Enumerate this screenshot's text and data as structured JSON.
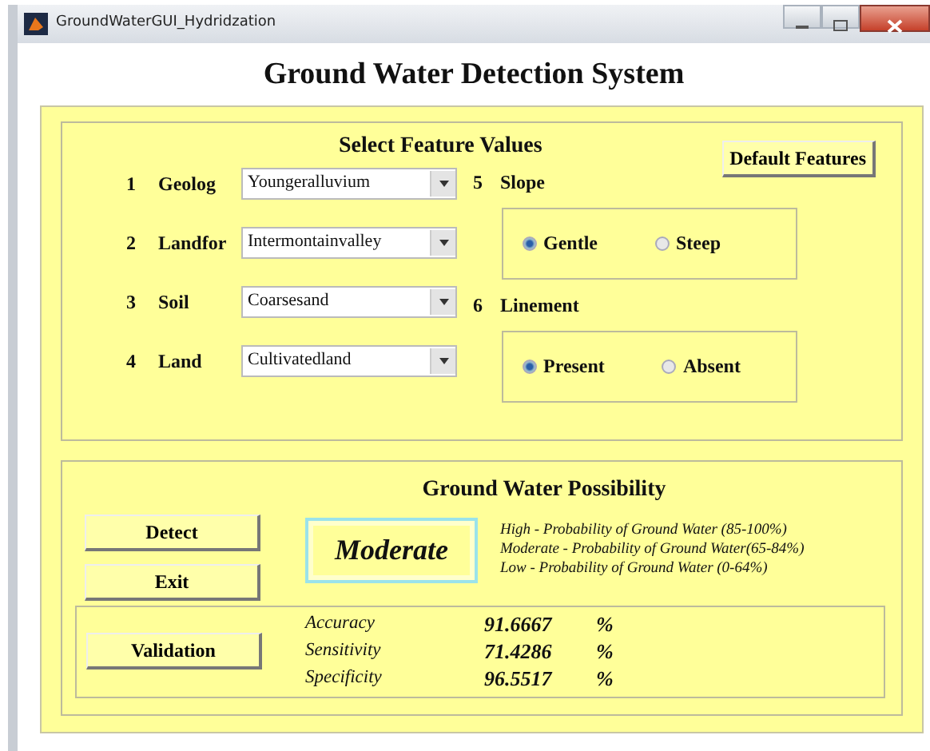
{
  "window": {
    "title": "GroundWaterGUI_Hydridzation"
  },
  "heading": "Ground Water Detection System",
  "features": {
    "title": "Select Feature Values",
    "default_button": "Default Features",
    "dropdowns": [
      {
        "number": "1",
        "label": "Geolog",
        "value": "Youngeralluvium"
      },
      {
        "number": "2",
        "label": "Landfor",
        "value": "Intermontainvalley"
      },
      {
        "number": "3",
        "label": "Soil",
        "value": "Coarsesand"
      },
      {
        "number": "4",
        "label": "Land",
        "value": "Cultivatedland"
      }
    ],
    "radio_groups": [
      {
        "number": "5",
        "label": "Slope",
        "options": [
          {
            "label": "Gentle",
            "selected": true
          },
          {
            "label": "Steep",
            "selected": false
          }
        ]
      },
      {
        "number": "6",
        "label": "Linement",
        "options": [
          {
            "label": "Present",
            "selected": true
          },
          {
            "label": "Absent",
            "selected": false
          }
        ]
      }
    ]
  },
  "possibility": {
    "title": "Ground Water Possibility",
    "buttons": [
      "Detect",
      "Exit"
    ],
    "result": "Moderate",
    "legend": [
      "High - Probability of Ground Water (85-100%)",
      "Moderate - Probability of Ground Water(65-84%)",
      "Low - Probability of Ground Water (0-64%)"
    ],
    "validation_button": "Validation",
    "metrics": [
      {
        "label": "Accuracy",
        "value": "91.6667",
        "unit": "%"
      },
      {
        "label": "Sensitivity",
        "value": "71.4286",
        "unit": "%"
      },
      {
        "label": "Specificity",
        "value": "96.5517",
        "unit": "%"
      }
    ]
  }
}
